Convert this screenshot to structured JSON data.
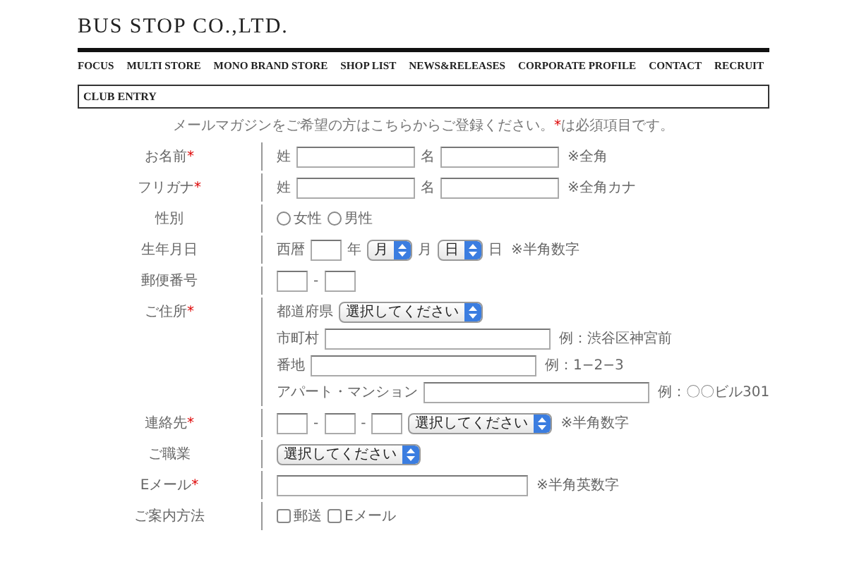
{
  "brand": "BUS STOP CO.,LTD.",
  "nav": [
    "FOCUS",
    "MULTI STORE",
    "MONO BRAND STORE",
    "SHOP LIST",
    "NEWS&RELEASES",
    "CORPORATE PROFILE",
    "CONTACT",
    "RECRUIT"
  ],
  "section_title": "CLUB ENTRY",
  "intro": {
    "text": "メールマガジンをご希望の方はこちらからご登録ください。",
    "mark": "*",
    "after": "は必須項目です。"
  },
  "rows": [
    {
      "label": "お名前",
      "required": true,
      "lines": [
        [
          {
            "kind": "text",
            "text": "姓"
          },
          {
            "kind": "field"
          },
          {
            "kind": "text",
            "text": "名"
          },
          {
            "kind": "field"
          },
          {
            "kind": "note",
            "text": "※全角"
          }
        ]
      ]
    },
    {
      "label": "フリガナ",
      "required": true,
      "lines": [
        [
          {
            "kind": "text",
            "text": "姓"
          },
          {
            "kind": "field"
          },
          {
            "kind": "text",
            "text": "名"
          },
          {
            "kind": "field"
          },
          {
            "kind": "note",
            "text": "※全角カナ"
          }
        ]
      ]
    },
    {
      "label": "性別",
      "required": false,
      "lines": [
        [
          {
            "kind": "radio",
            "text": "女性",
            "selected": false
          },
          {
            "kind": "radio",
            "text": "男性",
            "selected": false
          }
        ]
      ]
    },
    {
      "label": "生年月日",
      "required": false,
      "lines": [
        [
          {
            "kind": "text",
            "text": "西暦"
          },
          {
            "kind": "short_field"
          },
          {
            "kind": "text",
            "text": "年"
          },
          {
            "kind": "select",
            "text": "月"
          },
          {
            "kind": "text",
            "text": "月"
          },
          {
            "kind": "select",
            "text": "日"
          },
          {
            "kind": "text",
            "text": "日"
          },
          {
            "kind": "note",
            "text": "※半角数字"
          }
        ]
      ]
    },
    {
      "label": "郵便番号",
      "required": false,
      "lines": [
        [
          {
            "kind": "short_field"
          },
          {
            "kind": "text",
            "text": "-"
          },
          {
            "kind": "short_field"
          }
        ]
      ]
    },
    {
      "label": "ご住所",
      "required": true,
      "lines": [
        [
          {
            "kind": "text",
            "text": "都道府県"
          },
          {
            "kind": "select",
            "text": "選択してください"
          }
        ],
        [
          {
            "kind": "text",
            "text": "市町村"
          },
          {
            "kind": "wide_field"
          },
          {
            "kind": "note",
            "text": "例：渋谷区神宮前"
          }
        ],
        [
          {
            "kind": "text",
            "text": "番地"
          },
          {
            "kind": "wide_field"
          },
          {
            "kind": "note",
            "text": "例：1−2−3"
          }
        ],
        [
          {
            "kind": "text",
            "text": "アパート・マンション"
          },
          {
            "kind": "wide_field"
          },
          {
            "kind": "note",
            "text": "例：〇〇ビル301"
          }
        ]
      ]
    },
    {
      "label": "連絡先",
      "required": true,
      "lines": [
        [
          {
            "kind": "short_field"
          },
          {
            "kind": "text",
            "text": "-"
          },
          {
            "kind": "short_field"
          },
          {
            "kind": "text",
            "text": "-"
          },
          {
            "kind": "short_field"
          },
          {
            "kind": "select",
            "text": "選択してください"
          },
          {
            "kind": "note",
            "text": "※半角数字"
          }
        ]
      ]
    },
    {
      "label": "ご職業",
      "required": false,
      "lines": [
        [
          {
            "kind": "select",
            "text": "選択してください"
          }
        ]
      ]
    },
    {
      "label": "Eメール",
      "required": true,
      "lines": [
        [
          {
            "kind": "email_field"
          },
          {
            "kind": "note",
            "text": "※半角英数字"
          }
        ]
      ]
    },
    {
      "label": "ご案内方法",
      "required": false,
      "lines": [
        [
          {
            "kind": "checkbox",
            "text": "郵送",
            "checked": false
          },
          {
            "kind": "checkbox",
            "text": "Eメール",
            "checked": false
          }
        ]
      ]
    }
  ]
}
